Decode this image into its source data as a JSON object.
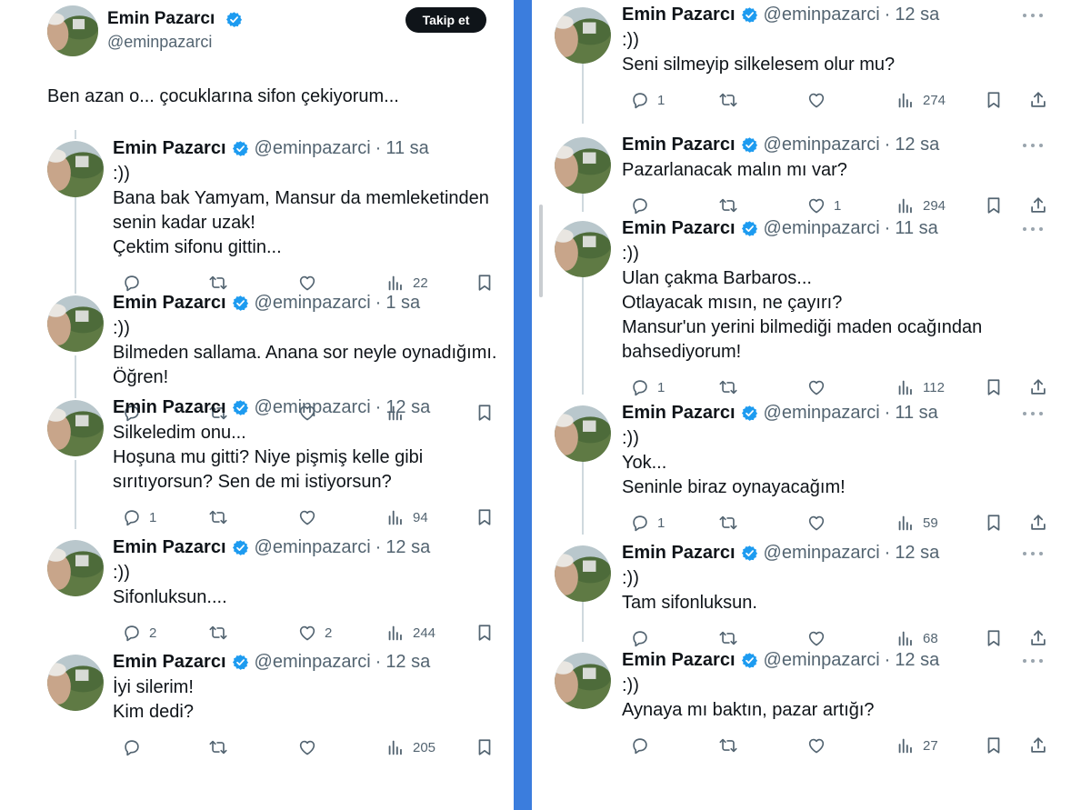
{
  "header": {
    "name": "Emin Pazarcı",
    "handle": "@eminpazarci",
    "follow_label": "Takip et",
    "text": "Ben azan o... çocuklarına sifon çekiyorum..."
  },
  "left_tweets": [
    {
      "name": "Emin Pazarcı",
      "handle": "@eminpazarci",
      "dot": "·",
      "time": "11 sa",
      "lines": [
        ":))",
        "Bana bak Yamyam, Mansur da memleketinden",
        "senin kadar uzak!",
        "Çektim sifonu gittin..."
      ],
      "replies": "",
      "likes": "",
      "views": "22"
    },
    {
      "name": "Emin Pazarcı",
      "handle": "@eminpazarci",
      "dot": "·",
      "time": "1 sa",
      "lines": [
        ":))",
        "Bilmeden sallama. Anana sor neyle oynadığımı.",
        "Öğren!"
      ],
      "replies": "",
      "likes": "",
      "views": ""
    },
    {
      "name": "Emin Pazarcı",
      "handle": "@eminpazarci",
      "dot": "·",
      "time": "12 sa",
      "lines": [
        "Silkeledim onu...",
        "Hoşuna mu gitti? Niye pişmiş kelle gibi",
        "sırıtıyorsun? Sen de mi istiyorsun?"
      ],
      "replies": "1",
      "likes": "",
      "views": "94"
    },
    {
      "name": "Emin Pazarcı",
      "handle": "@eminpazarci",
      "dot": "·",
      "time": "12 sa",
      "lines": [
        ":))",
        "Sifonluksun...."
      ],
      "replies": "2",
      "likes": "2",
      "views": "244"
    },
    {
      "name": "Emin Pazarcı",
      "handle": "@eminpazarci",
      "dot": "·",
      "time": "12 sa",
      "lines": [
        "İyi silerim!",
        "Kim dedi?"
      ],
      "replies": "",
      "likes": "",
      "views": "205"
    }
  ],
  "right_tweets": [
    {
      "name": "Emin Pazarcı",
      "handle": "@eminpazarci",
      "dot": "·",
      "time": "12 sa",
      "lines": [
        ":))",
        "Seni silmeyip silkelesem olur mu?"
      ],
      "replies": "1",
      "likes": "",
      "views": "274"
    },
    {
      "name": "Emin Pazarcı",
      "handle": "@eminpazarci",
      "dot": "·",
      "time": "12 sa",
      "lines": [
        "Pazarlanacak malın mı var?"
      ],
      "replies": "",
      "likes": "1",
      "views": "294"
    },
    {
      "name": "Emin Pazarcı",
      "handle": "@eminpazarci",
      "dot": "·",
      "time": "11 sa",
      "lines": [
        ":))",
        "Ulan çakma Barbaros...",
        "Otlayacak mısın, ne çayırı?",
        "Mansur'un yerini bilmediği maden ocağından",
        "bahsediyorum!"
      ],
      "replies": "1",
      "likes": "",
      "views": "112"
    },
    {
      "name": "Emin Pazarcı",
      "handle": "@eminpazarci",
      "dot": "·",
      "time": "11 sa",
      "lines": [
        ":))",
        "Yok...",
        "Seninle biraz oynayacağım!"
      ],
      "replies": "1",
      "likes": "",
      "views": "59"
    },
    {
      "name": "Emin Pazarcı",
      "handle": "@eminpazarci",
      "dot": "·",
      "time": "12 sa",
      "lines": [
        ":))",
        "Tam sifonluksun."
      ],
      "replies": "",
      "likes": "",
      "views": "68"
    },
    {
      "name": "Emin Pazarcı",
      "handle": "@eminpazarci",
      "dot": "·",
      "time": "12 sa",
      "lines": [
        ":))",
        "Aynaya mı baktın, pazar artığı?"
      ],
      "replies": "",
      "likes": "",
      "views": "27"
    }
  ],
  "icons": {
    "verified": "verified-badge-icon",
    "reply": "reply-icon",
    "retweet": "retweet-icon",
    "like": "heart-icon",
    "views": "views-icon",
    "bookmark": "bookmark-icon",
    "share": "share-icon",
    "more": "more-icon"
  },
  "colors": {
    "accent": "#1d9bf0",
    "divider": "#3b7ddd",
    "text": "#0f1419",
    "muted": "#536471"
  }
}
